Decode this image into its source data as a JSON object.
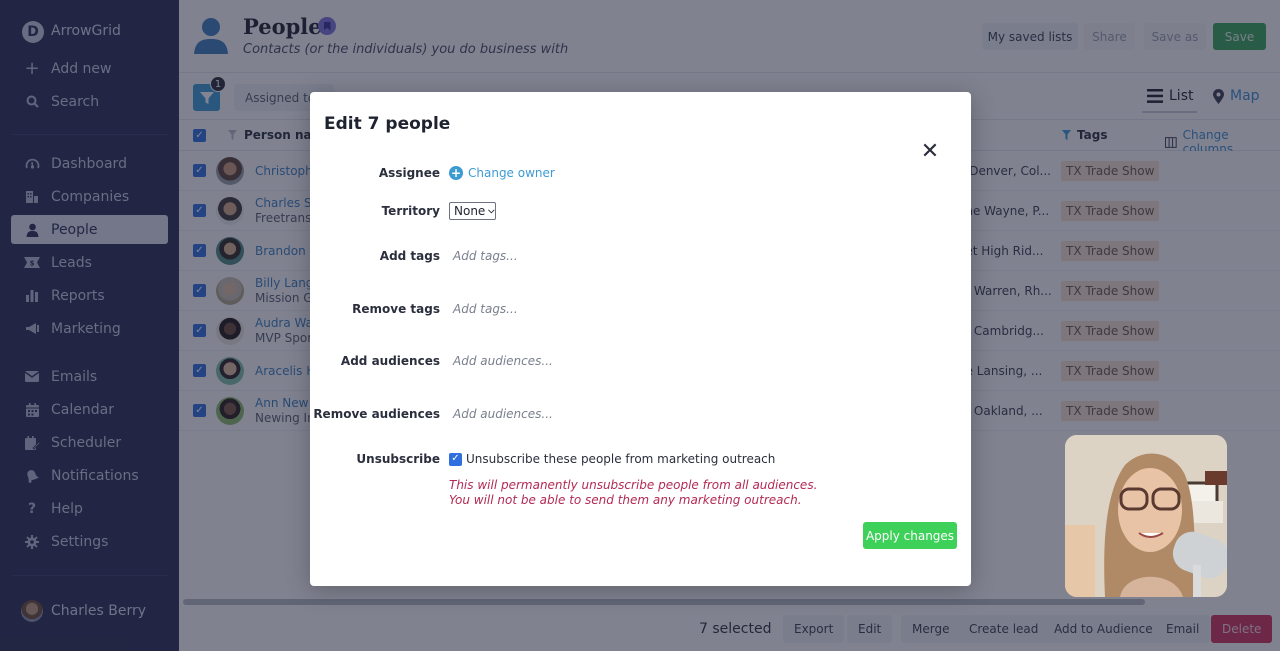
{
  "sidebar": {
    "brand": "ArrowGrid",
    "logo_letter": "D",
    "top_items": [
      {
        "label": "Add new",
        "icon": "plus-icon"
      },
      {
        "label": "Search",
        "icon": "search-icon"
      }
    ],
    "nav_items": [
      {
        "label": "Dashboard",
        "icon": "gauge-icon"
      },
      {
        "label": "Companies",
        "icon": "building-icon"
      },
      {
        "label": "People",
        "icon": "person-icon",
        "active": true
      },
      {
        "label": "Leads",
        "icon": "money-ticket-icon"
      },
      {
        "label": "Reports",
        "icon": "bar-chart-icon"
      },
      {
        "label": "Marketing",
        "icon": "megaphone-icon"
      }
    ],
    "tool_items": [
      {
        "label": "Emails",
        "icon": "envelope-icon"
      },
      {
        "label": "Calendar",
        "icon": "calendar-icon"
      },
      {
        "label": "Scheduler",
        "icon": "calendar-edit-icon"
      },
      {
        "label": "Notifications",
        "icon": "bell-icon"
      },
      {
        "label": "Help",
        "icon": "question-icon"
      },
      {
        "label": "Settings",
        "icon": "gear-icon"
      }
    ],
    "user_name": "Charles Berry"
  },
  "header": {
    "title": "People",
    "subtitle": "Contacts (or the individuals) you do business with",
    "buttons": {
      "saved_lists": "My saved lists",
      "share": "Share",
      "save_as": "Save as",
      "save": "Save"
    }
  },
  "toolbar": {
    "filter_count": "1",
    "filter_chip": "Assigned to",
    "view_list": "List",
    "view_map": "Map"
  },
  "table": {
    "columns": {
      "person_name": "Person name",
      "tags": "Tags",
      "change_columns": "Change columns"
    },
    "rows": [
      {
        "name": "Christophe",
        "company": "",
        "address": "e Denver, Col...",
        "tag": "TX Trade Show"
      },
      {
        "name": "Charles Sh",
        "company": "Freetrans",
        "address": "ane Wayne, P...",
        "tag": "TX Trade Show"
      },
      {
        "name": "Brandon W",
        "company": "",
        "address": "eet High Rid...",
        "tag": "TX Trade Show"
      },
      {
        "name": "Billy Lango",
        "company": "Mission G",
        "address": "et Warren, Rh...",
        "tag": "TX Trade Show"
      },
      {
        "name": "Audra Wal",
        "company": "MVP Sport",
        "address": "et Cambridg...",
        "tag": "TX Trade Show"
      },
      {
        "name": "Aracelis H",
        "company": "",
        "address": "ue Lansing, ...",
        "tag": "TX Trade Show"
      },
      {
        "name": "Ann New",
        "company": "Newing In",
        "address": "et Oakland, ...",
        "tag": "TX Trade Show"
      }
    ]
  },
  "bottom_bar": {
    "selected_count": "7 selected",
    "actions": [
      "Export",
      "Edit",
      "Merge",
      "Create lead",
      "Add to Audience",
      "Email"
    ],
    "delete": "Delete"
  },
  "modal": {
    "title": "Edit 7 people",
    "close_icon": "close-icon",
    "fields": {
      "assignee": {
        "label": "Assignee",
        "action": "Change owner"
      },
      "territory": {
        "label": "Territory",
        "value": "None"
      },
      "add_tags": {
        "label": "Add tags",
        "placeholder": "Add tags..."
      },
      "remove_tags": {
        "label": "Remove tags",
        "placeholder": "Add tags..."
      },
      "add_audiences": {
        "label": "Add audiences",
        "placeholder": "Add audiences..."
      },
      "remove_audiences": {
        "label": "Remove audiences",
        "placeholder": "Add audiences..."
      },
      "unsubscribe": {
        "label": "Unsubscribe",
        "checkbox_label": "Unsubscribe these people from marketing outreach",
        "checked": true,
        "warning": "This will permanently unsubscribe people from all audiences. You will not be able to send them any marketing outreach."
      }
    },
    "apply_label": "Apply changes"
  },
  "colors": {
    "sidebar_bg": "#2a2e52",
    "accent_blue": "#3d9bd4",
    "save_green": "#3aa65a",
    "apply_green": "#3ed15a",
    "danger": "#d0345e",
    "warning_text": "#b22a55",
    "tag_bg": "#f3e3d2"
  }
}
